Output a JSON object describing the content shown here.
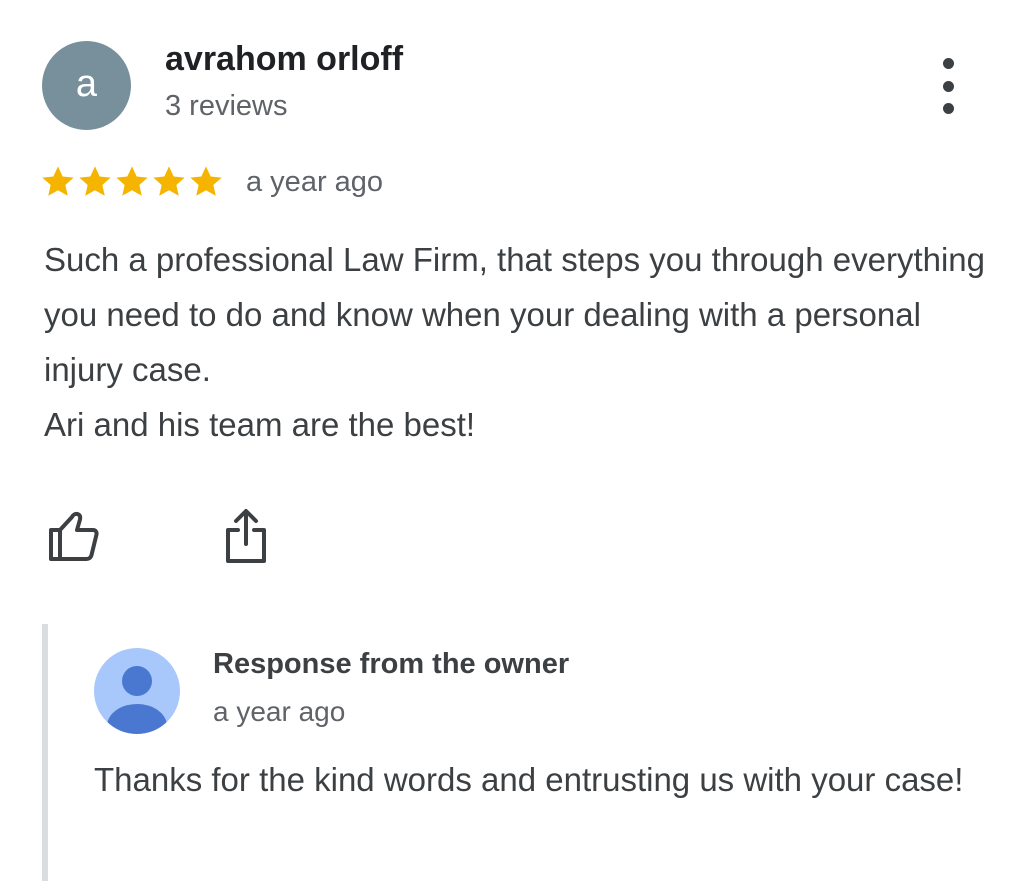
{
  "review": {
    "author": {
      "initial": "a",
      "name": "avrahom orloff",
      "meta": "3 reviews"
    },
    "rating": 5,
    "rating_max": 5,
    "date": "a year ago",
    "paragraphs": [
      "Such a professional Law Firm, that steps you through everything you need to do and know when your dealing with a personal injury case.",
      "Ari and his team are the best!"
    ]
  },
  "actions": {
    "like_icon": "thumbs-up-outline-icon",
    "share_icon": "share-icon",
    "more_icon": "more-vertical-icon"
  },
  "owner_response": {
    "title": "Response from the owner",
    "date": "a year ago",
    "text": "Thanks for the kind words and entrusting us with your case!"
  },
  "colors": {
    "star": "#f4b400",
    "author_avatar": "#78909c",
    "owner_avatar": "#a8c7fa",
    "owner_avatar_figure": "#4a78d0",
    "response_bar": "#dadce0",
    "text_primary": "#202124",
    "text_body": "#3c4043",
    "text_secondary": "#5f6368"
  }
}
